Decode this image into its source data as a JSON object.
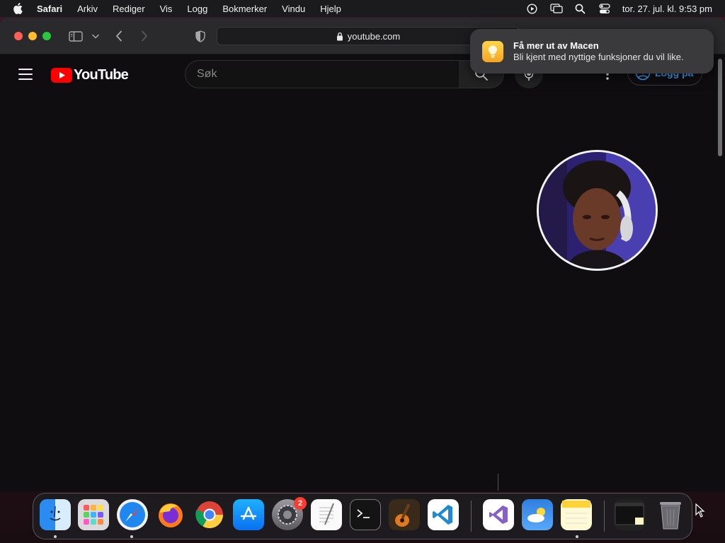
{
  "menubar": {
    "app_name": "Safari",
    "items": [
      "Arkiv",
      "Rediger",
      "Vis",
      "Logg",
      "Bokmerker",
      "Vindu",
      "Hjelp"
    ],
    "clock": "tor. 27. jul. kl. 9:53 pm",
    "status_icons": [
      "screen-record-icon",
      "screen-mirroring-icon",
      "spotlight-search-icon",
      "control-center-icon"
    ]
  },
  "browser": {
    "url": "youtube.com",
    "toolbar_icons": [
      "sidebar-icon",
      "chevron-down-icon",
      "back-icon",
      "forward-icon",
      "privacy-shield-icon",
      "lock-icon"
    ]
  },
  "youtube": {
    "logo_text": "YouTube",
    "search_placeholder": "Søk",
    "login_label": "Logg på",
    "brand_color": "#ff0000",
    "link_color": "#3ea6ff"
  },
  "notification": {
    "title": "Få mer ut av Macen",
    "body": "Bli kjent med nyttige funksjoner du vil like.",
    "icon": "lightbulb-icon"
  },
  "dock": {
    "apps": [
      "Finder",
      "Launchpad",
      "Safari",
      "Firefox",
      "Google Chrome",
      "App Store",
      "Systeminnstillinger",
      "TextEdit",
      "Terminal",
      "GarageBand",
      "Visual Studio Code",
      "Visual Studio",
      "Været",
      "Notater",
      "Window preview",
      "Papirkurv"
    ],
    "system_settings_badge": "2"
  }
}
